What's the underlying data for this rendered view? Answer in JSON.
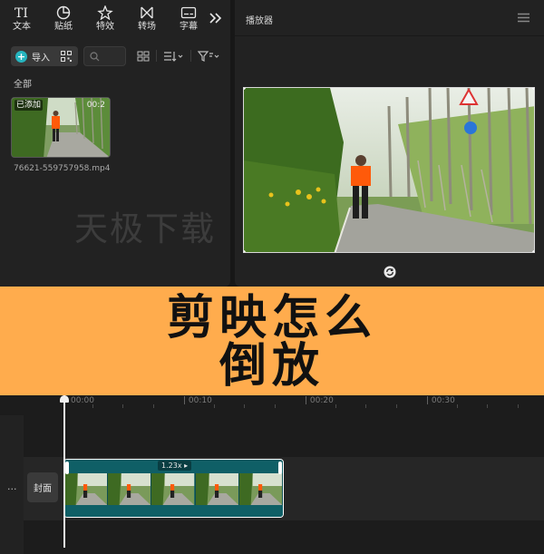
{
  "toolbar": {
    "items": [
      {
        "label": "文本",
        "icon": "text-icon"
      },
      {
        "label": "贴纸",
        "icon": "sticker-icon"
      },
      {
        "label": "特效",
        "icon": "effects-icon"
      },
      {
        "label": "转场",
        "icon": "transition-icon"
      },
      {
        "label": "字幕",
        "icon": "subtitle-icon"
      }
    ],
    "more_icon": "double-chevron-right-icon"
  },
  "media": {
    "import_label": "导入",
    "search_placeholder": "",
    "filter_all": "全部",
    "items": [
      {
        "filename": "76621-559757958.mp4",
        "badge": "已添加",
        "duration": "00:2"
      }
    ]
  },
  "watermark": "天极下载",
  "player": {
    "title": "播放器"
  },
  "banner": {
    "line1": "剪映怎么",
    "line2": "倒放"
  },
  "timeline": {
    "ticks": [
      "00:00",
      "| 00:10",
      "| 00:20",
      "| 00:30"
    ],
    "cover_label": "封面",
    "more_label": "···",
    "clip": {
      "speed": "1.23x ▸"
    }
  },
  "colors": {
    "accent": "#26b5bf",
    "banner": "#ffac4d",
    "clip": "#0f5f66"
  }
}
